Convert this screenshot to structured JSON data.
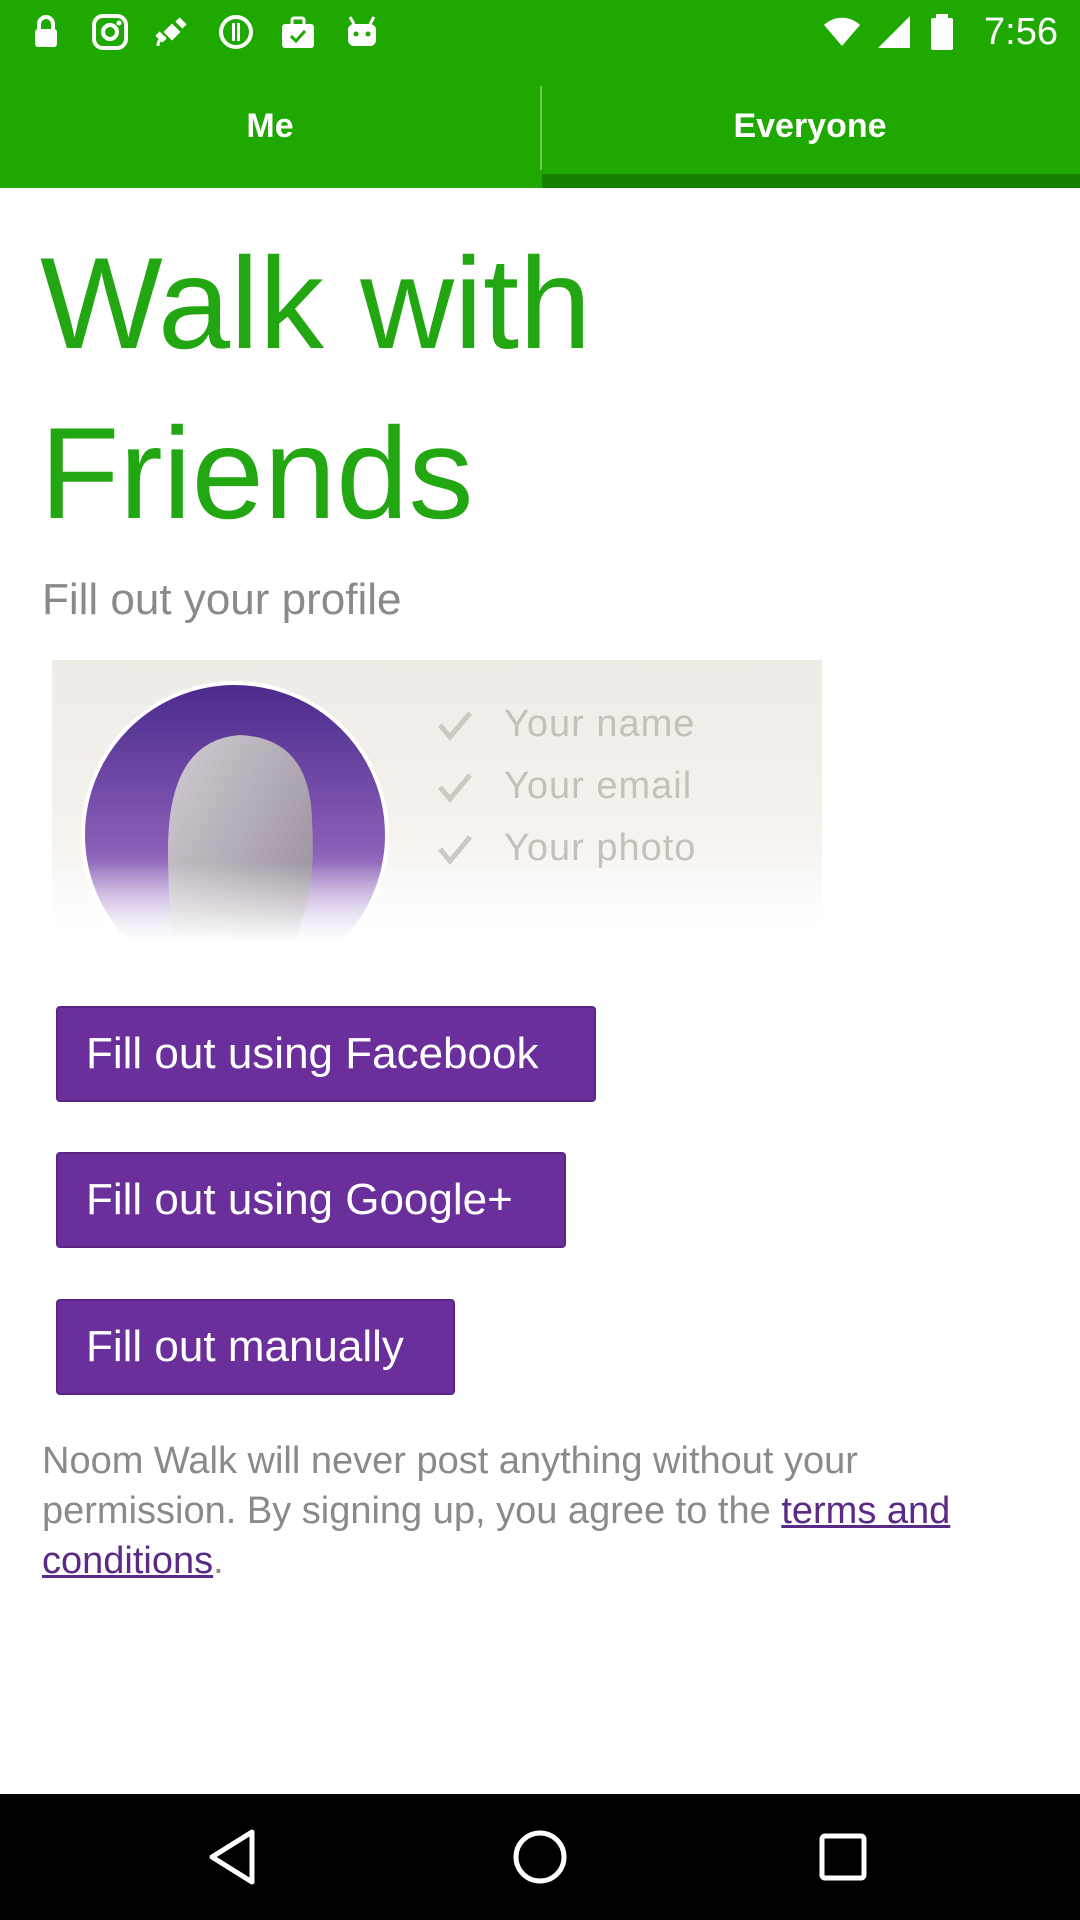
{
  "status_bar": {
    "time": "7:56",
    "notification_icons": [
      "lock-icon",
      "instagram-icon",
      "fake-gps-icon",
      "info-icon",
      "briefcase-icon",
      "android-icon"
    ],
    "system_icons": [
      "wifi-icon",
      "signal-icon",
      "battery-icon"
    ]
  },
  "tabs": [
    {
      "label": "Me",
      "selected": false
    },
    {
      "label": "Everyone",
      "selected": true
    }
  ],
  "content": {
    "title_line1": "Walk with",
    "title_line2": "Friends",
    "subtitle": "Fill out your profile",
    "checklist": [
      "Your name",
      "Your email",
      "Your photo"
    ]
  },
  "buttons": {
    "facebook": "Fill out using Facebook",
    "google": "Fill out using Google+",
    "manual": "Fill out manually"
  },
  "disclaimer": {
    "text": "Noom Walk will never post anything without your permission. By signing up, you agree to the ",
    "link": "terms and conditions",
    "end": "."
  },
  "nav_bar": {
    "buttons": [
      "back-icon",
      "home-icon",
      "recent-apps-icon"
    ]
  },
  "colors": {
    "brand_green": "#1fa800",
    "title_green": "#22a712",
    "button_purple": "#6a2f9b"
  }
}
